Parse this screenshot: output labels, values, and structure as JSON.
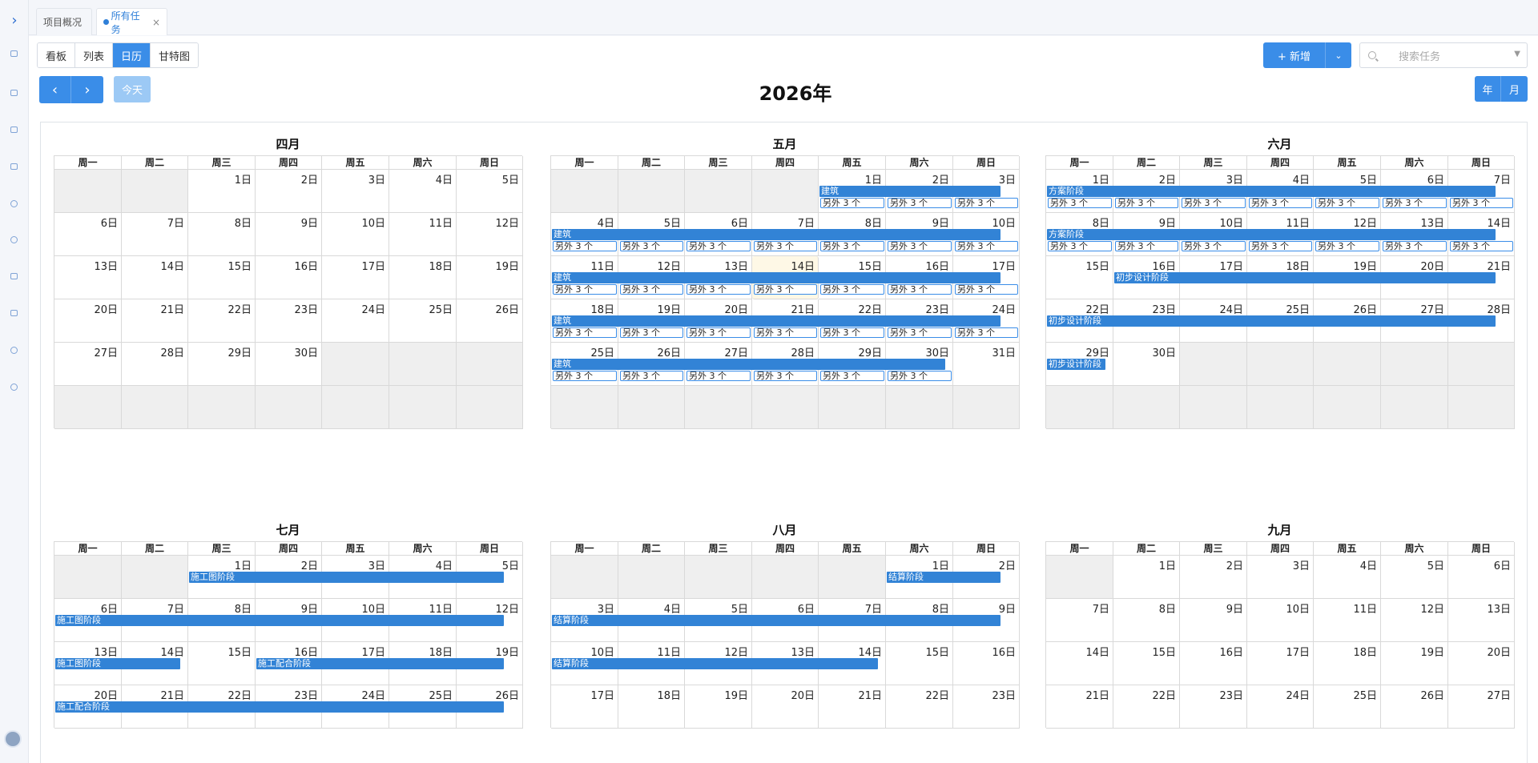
{
  "tabs": [
    {
      "label": "项目概况",
      "active": false
    },
    {
      "label": "所有任务",
      "active": true
    }
  ],
  "views": [
    "看板",
    "列表",
    "日历",
    "甘特图"
  ],
  "active_view": "日历",
  "nav": {
    "today": "今天",
    "prev_icon": "chevron-left-icon",
    "next_icon": "chevron-right-icon"
  },
  "year_title": "2026年",
  "add_button": "+ 新增",
  "search_placeholder": "搜索任务",
  "mode_buttons": [
    "年",
    "月"
  ],
  "weekdays": [
    "周一",
    "周二",
    "周三",
    "周四",
    "周五",
    "周六",
    "周日"
  ],
  "colors": {
    "accent": "#3a8de8",
    "bar": "#3283d6",
    "outside": "#efefef",
    "today": "#fef8e6"
  },
  "months": [
    {
      "name": "四月",
      "days": 30,
      "first_weekday": 2,
      "bars": [],
      "more_days": []
    },
    {
      "name": "五月",
      "days": 31,
      "first_weekday": 4,
      "highlight_day": 14,
      "bars": [
        {
          "start": 1,
          "end": 3,
          "label": "建筑"
        },
        {
          "start": 4,
          "end": 10,
          "label": "建筑"
        },
        {
          "start": 11,
          "end": 17,
          "label": "建筑"
        },
        {
          "start": 18,
          "end": 24,
          "label": "建筑"
        },
        {
          "start": 25,
          "end": 30,
          "label": "建筑"
        }
      ],
      "more_days": [
        1,
        2,
        3,
        4,
        5,
        6,
        7,
        8,
        9,
        10,
        11,
        12,
        13,
        14,
        15,
        16,
        17,
        18,
        19,
        20,
        21,
        22,
        23,
        24,
        25,
        26,
        27,
        28,
        29,
        30
      ],
      "more_label": "另外 3 个"
    },
    {
      "name": "六月",
      "days": 30,
      "first_weekday": 0,
      "bars": [
        {
          "start": 1,
          "end": 7,
          "label": "方案阶段"
        },
        {
          "start": 8,
          "end": 14,
          "label": "方案阶段"
        },
        {
          "start": 16,
          "end": 21,
          "label": "初步设计阶段"
        },
        {
          "start": 22,
          "end": 28,
          "label": "初步设计阶段"
        },
        {
          "start": 29,
          "end": 29,
          "label": "初步设计阶段"
        }
      ],
      "more_days": [
        1,
        2,
        3,
        4,
        5,
        6,
        7,
        8,
        9,
        10,
        11,
        12,
        13,
        14
      ],
      "more_label": "另外 3 个"
    },
    {
      "name": "七月",
      "days": 31,
      "first_weekday": 2,
      "bars": [
        {
          "start": 1,
          "end": 5,
          "label": "施工图阶段"
        },
        {
          "start": 6,
          "end": 12,
          "label": "施工图阶段"
        },
        {
          "start": 13,
          "end": 14,
          "label": "施工图阶段"
        },
        {
          "start": 16,
          "end": 19,
          "label": "施工配合阶段"
        },
        {
          "start": 20,
          "end": 26,
          "label": "施工配合阶段"
        }
      ],
      "more_days": []
    },
    {
      "name": "八月",
      "days": 31,
      "first_weekday": 5,
      "bars": [
        {
          "start": 1,
          "end": 2,
          "label": "结算阶段"
        },
        {
          "start": 3,
          "end": 9,
          "label": "结算阶段"
        },
        {
          "start": 10,
          "end": 14,
          "label": "结算阶段"
        }
      ],
      "more_days": []
    },
    {
      "name": "九月",
      "days": 30,
      "first_weekday": 1,
      "bars": [],
      "more_days": []
    }
  ]
}
